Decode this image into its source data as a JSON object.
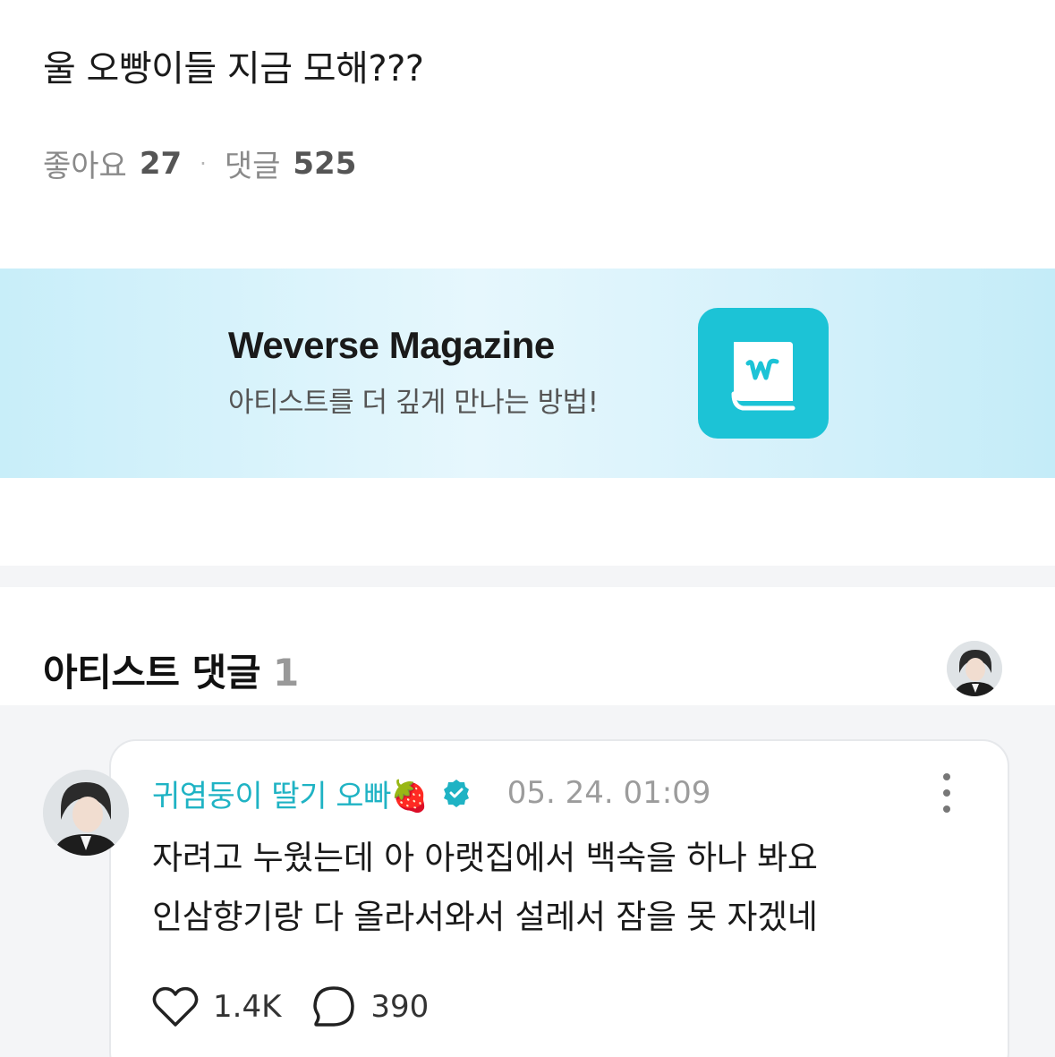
{
  "post": {
    "title": "울 오빵이들 지금 모해???",
    "likes_label": "좋아요",
    "likes_count": "27",
    "separator": "·",
    "comments_label": "댓글",
    "comments_count": "525"
  },
  "banner": {
    "title": "Weverse Magazine",
    "subtitle": "아티스트를 더 깊게 만나는 방법!",
    "logo_icon": "weverse-book-icon",
    "accent_color": "#1cc3d6"
  },
  "artist_comments": {
    "title": "아티스트 댓글",
    "count": "1",
    "avatar_icon": "artist-avatar"
  },
  "comment": {
    "author": "귀염둥이 딸기 오빠🍓",
    "verified_icon": "verified-badge-icon",
    "timestamp": "05. 24. 01:09",
    "more_icon": "more-vertical-icon",
    "lines": [
      "자려고 누웠는데 아 아랫집에서 백숙을 하나 봐요",
      "인삼향기랑 다 올라서와서 설레서 잠을 못 자겠네"
    ],
    "likes": "1.4K",
    "replies": "390",
    "like_icon": "heart-icon",
    "reply_icon": "comment-bubble-icon",
    "author_color": "#1fb3c4"
  }
}
